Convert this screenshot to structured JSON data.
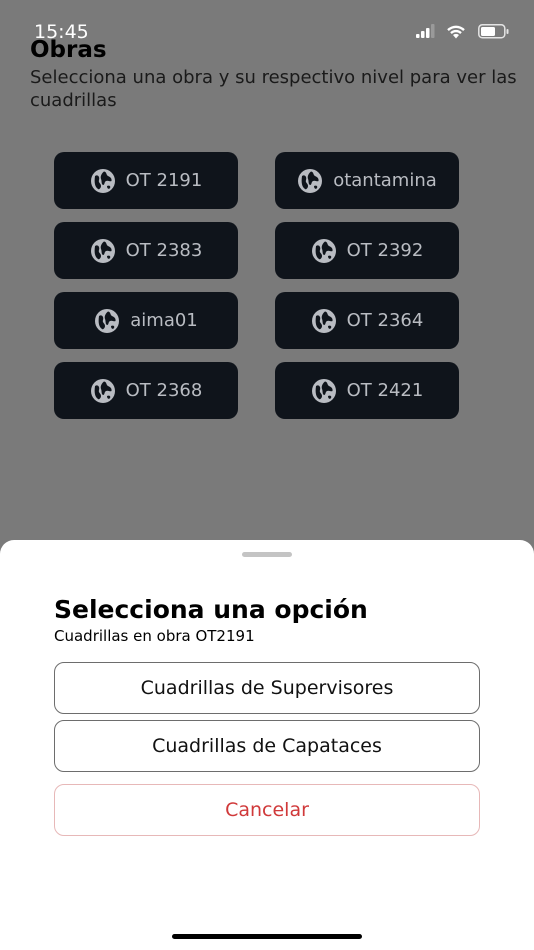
{
  "status_bar": {
    "time": "15:45"
  },
  "header": {
    "title": "Obras",
    "subtitle": "Selecciona una obra y su respectivo nivel para ver las cuadrillas"
  },
  "obras": [
    {
      "label": "OT 2191",
      "icon": "globe-icon"
    },
    {
      "label": "otantamina",
      "icon": "globe-icon"
    },
    {
      "label": "OT 2383",
      "icon": "globe-icon"
    },
    {
      "label": "OT 2392",
      "icon": "globe-icon"
    },
    {
      "label": "aima01",
      "icon": "globe-icon"
    },
    {
      "label": "OT 2364",
      "icon": "globe-icon"
    },
    {
      "label": "OT 2368",
      "icon": "globe-icon"
    },
    {
      "label": "OT 2421",
      "icon": "globe-icon"
    }
  ],
  "sheet": {
    "title": "Selecciona una opción",
    "subtitle": "Cuadrillas en obra OT2191",
    "options": [
      {
        "label": "Cuadrillas de Supervisores"
      },
      {
        "label": "Cuadrillas de Capataces"
      }
    ],
    "cancel_label": "Cancelar"
  },
  "colors": {
    "backdrop": "#7a7a7a",
    "obra_button_bg": "#0f141b",
    "obra_button_text": "#b9bcc2",
    "cancel_text": "#d0393a"
  }
}
